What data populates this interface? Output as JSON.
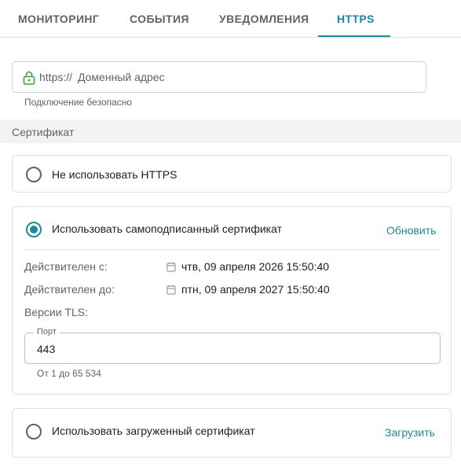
{
  "tabs": [
    {
      "label": "МОНИТОРИНГ"
    },
    {
      "label": "СОБЫТИЯ"
    },
    {
      "label": "УВЕДОМЛЕНИЯ"
    },
    {
      "label": "HTTPS"
    }
  ],
  "active_tab": "HTTPS",
  "domain": {
    "prefix": "https://",
    "placeholder": "Доменный адрес",
    "value": "",
    "icon": "lock-icon",
    "hint": "Подключение безопасно"
  },
  "certificate": {
    "title": "Сертификат",
    "options": [
      {
        "label": "Не использовать HTTPS",
        "selected": false
      },
      {
        "label": "Использовать самоподписанный сертификат",
        "selected": true,
        "action": "Обновить"
      },
      {
        "label": "Использовать загруженный сертификат",
        "selected": false,
        "action": "Загрузить"
      }
    ],
    "details": {
      "valid_from_label": "Действителен с:",
      "valid_from": "чтв, 09 апреля 2026 15:50:40",
      "valid_to_label": "Действителен до:",
      "valid_to": "птн, 09 апреля 2027 15:50:40",
      "tls_label": "Версии TLS:",
      "port_label": "Порт",
      "port_value": "443",
      "port_hint": "От 1 до 65 534"
    }
  },
  "colors": {
    "accent": "#1a8a9a",
    "secure": "#43a047"
  }
}
